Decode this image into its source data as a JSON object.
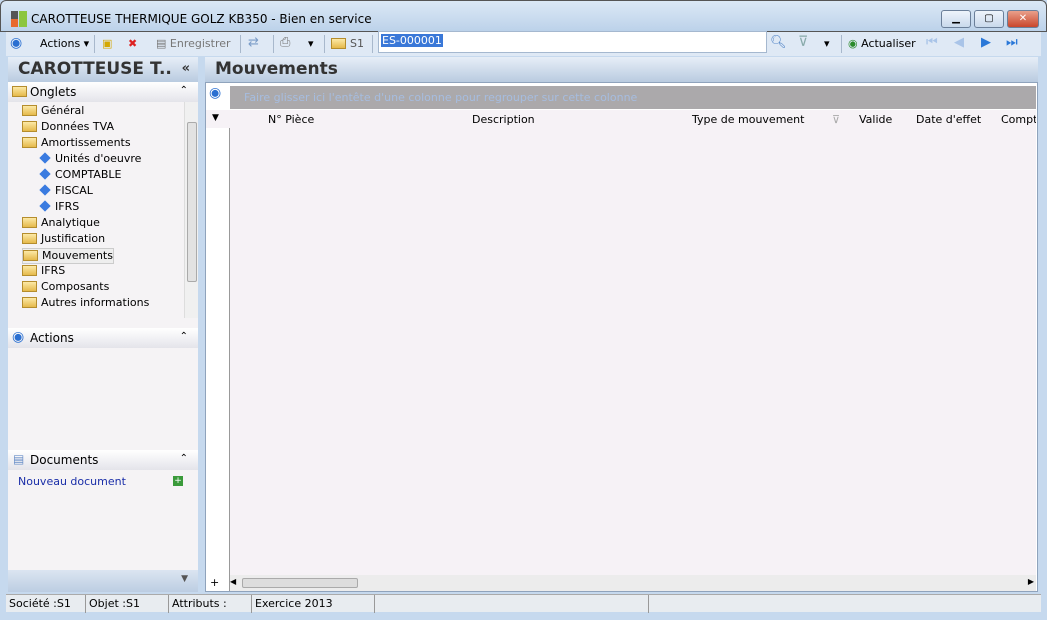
{
  "window": {
    "title": "CAROTTEUSE THERMIQUE GOLZ KB350 -  Bien en service"
  },
  "toolbar": {
    "actions": "Actions",
    "save": "Enregistrer",
    "folder": "S1",
    "search_value": "ES-000001",
    "refresh": "Actualiser"
  },
  "left": {
    "title": "CAROTTEUSE T..",
    "tabs_header": "Onglets",
    "actions_header": "Actions",
    "documents_header": "Documents",
    "new_document": "Nouveau document",
    "tree": [
      {
        "label": "Général",
        "level": 0
      },
      {
        "label": "Données TVA",
        "level": 0
      },
      {
        "label": "Amortissements",
        "level": 0
      },
      {
        "label": "Unités d'oeuvre",
        "level": 1
      },
      {
        "label": "COMPTABLE",
        "level": 1
      },
      {
        "label": "FISCAL",
        "level": 1
      },
      {
        "label": "IFRS",
        "level": 1
      },
      {
        "label": "Analytique",
        "level": 0
      },
      {
        "label": "Justification",
        "level": 0
      },
      {
        "label": "Mouvements",
        "level": 0
      },
      {
        "label": "IFRS",
        "level": 0
      },
      {
        "label": "Composants",
        "level": 0
      },
      {
        "label": "Autres informations",
        "level": 0
      }
    ]
  },
  "main": {
    "title": "Mouvements",
    "group_hint": "Faire glisser ici l'entête d'une colonne pour regrouper sur cette colonne",
    "columns": [
      "N° Pièce",
      "Description",
      "Type de mouvement",
      "Valide",
      "Date d'effet",
      "Compta"
    ]
  },
  "status": [
    "Société :S1",
    "Objet :S1",
    "Attributs :",
    "Exercice 2013"
  ]
}
